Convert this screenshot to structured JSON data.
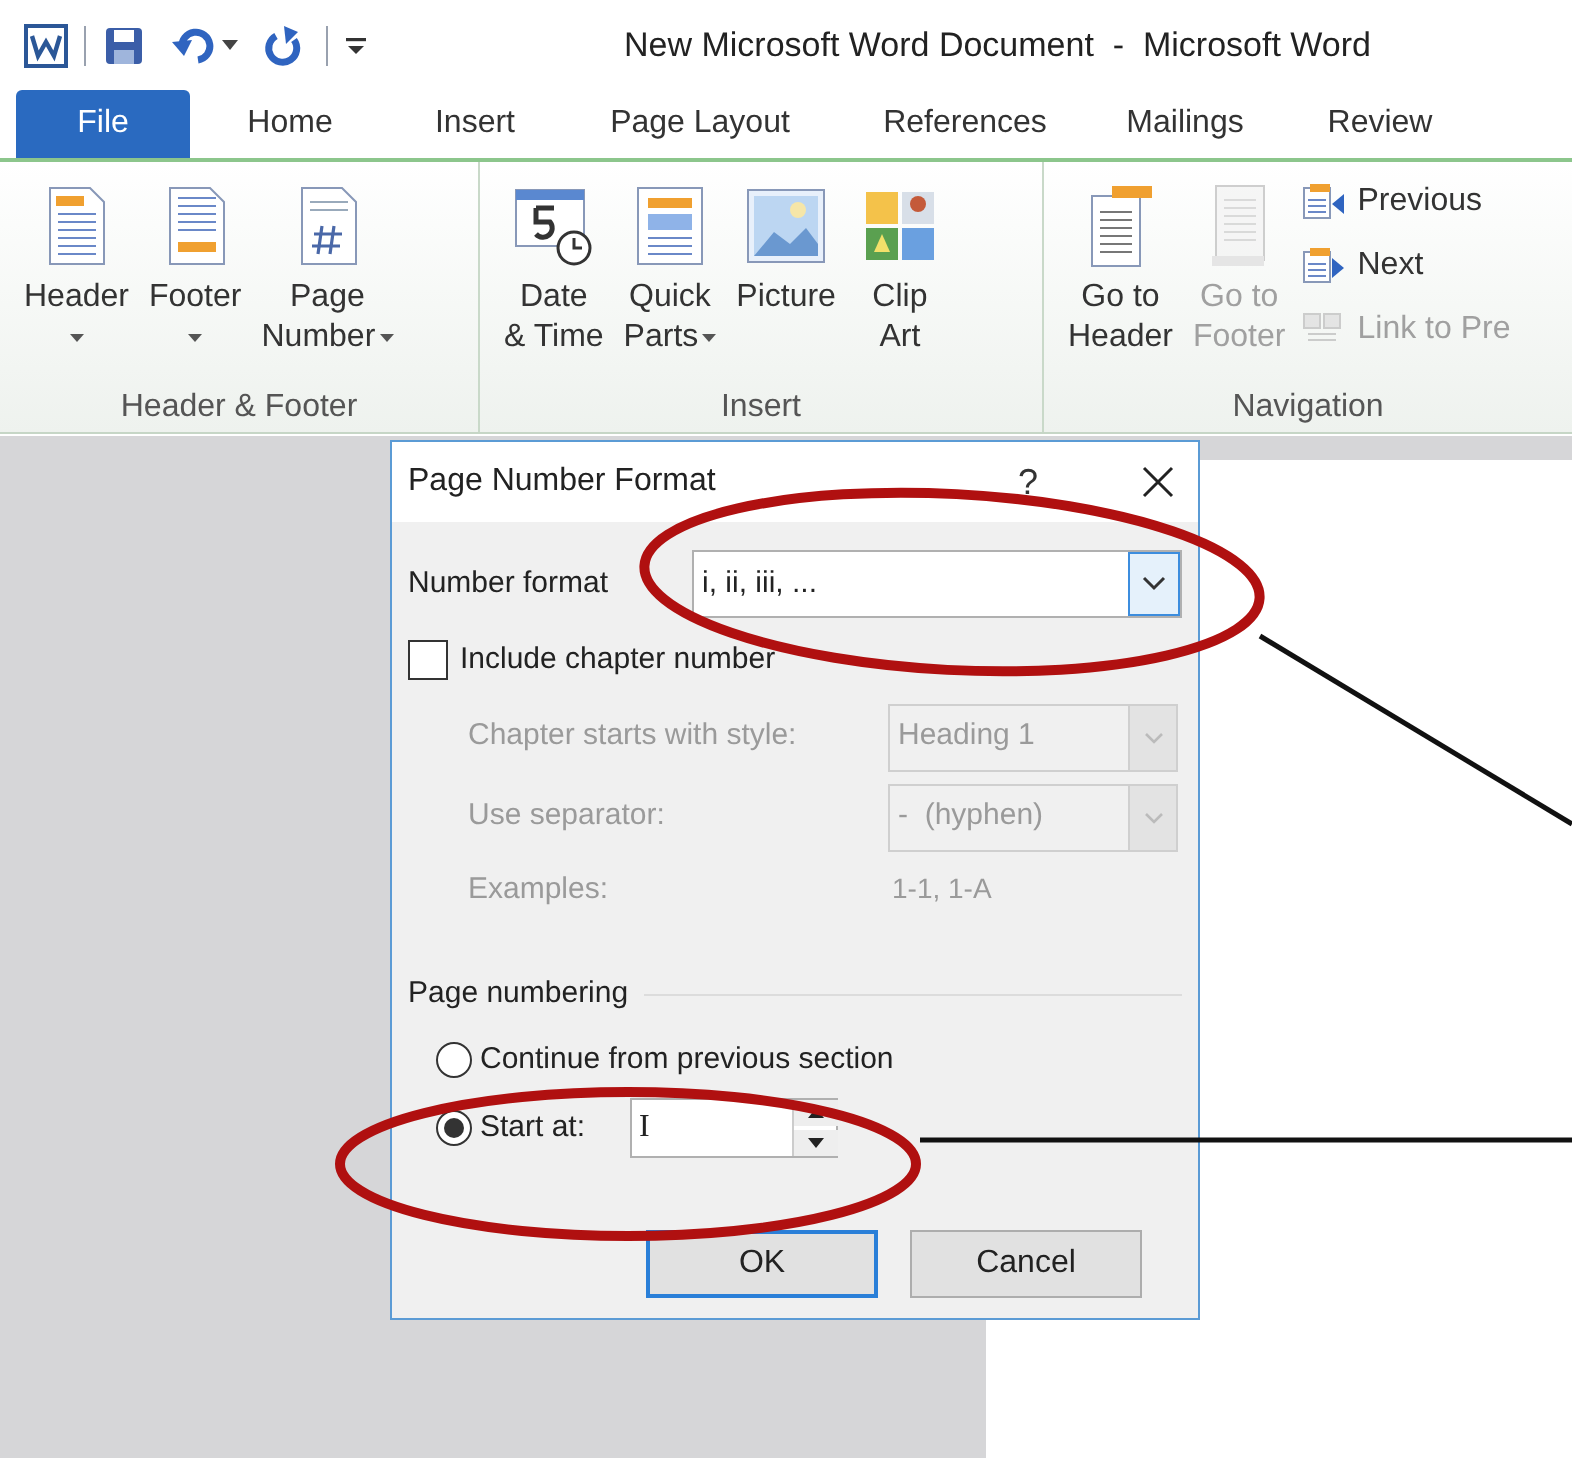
{
  "title_bar": {
    "title": "New Microsoft Word Document  -  Microsoft Word"
  },
  "tabs": [
    {
      "label": "File",
      "kind": "backstage",
      "selected": false
    },
    {
      "label": "Home",
      "kind": "tab",
      "selected": false
    },
    {
      "label": "Insert",
      "kind": "tab",
      "selected": false
    },
    {
      "label": "Page Layout",
      "kind": "tab",
      "selected": false
    },
    {
      "label": "References",
      "kind": "tab",
      "selected": false
    },
    {
      "label": "Mailings",
      "kind": "tab",
      "selected": false
    },
    {
      "label": "Review",
      "kind": "tab",
      "selected": false
    }
  ],
  "ribbon_groups": [
    {
      "label": "Header & Footer",
      "buttons": [
        {
          "kind": "large",
          "lines": [
            "Header"
          ],
          "dropdown": true,
          "disabled": false
        },
        {
          "kind": "large",
          "lines": [
            "Footer"
          ],
          "dropdown": true,
          "disabled": false
        },
        {
          "kind": "large",
          "lines": [
            "Page",
            "Number"
          ],
          "dropdown": true,
          "disabled": false
        }
      ]
    },
    {
      "label": "Insert",
      "buttons": [
        {
          "kind": "large",
          "lines": [
            "Date",
            "& Time"
          ],
          "dropdown": false,
          "disabled": false
        },
        {
          "kind": "large",
          "lines": [
            "Quick",
            "Parts"
          ],
          "dropdown": true,
          "disabled": false
        },
        {
          "kind": "large",
          "lines": [
            "Picture"
          ],
          "dropdown": false,
          "disabled": false
        },
        {
          "kind": "large",
          "lines": [
            "Clip",
            "Art"
          ],
          "dropdown": false,
          "disabled": false
        }
      ]
    },
    {
      "label": "Navigation",
      "buttons": [
        {
          "kind": "large",
          "lines": [
            "Go to",
            "Header"
          ],
          "dropdown": false,
          "disabled": false
        },
        {
          "kind": "large",
          "lines": [
            "Go to",
            "Footer"
          ],
          "dropdown": false,
          "disabled": true
        },
        {
          "kind": "small",
          "lines": [
            "Previous"
          ],
          "disabled": false
        },
        {
          "kind": "small",
          "lines": [
            "Next"
          ],
          "disabled": false
        },
        {
          "kind": "small",
          "lines": [
            "Link to Pre"
          ],
          "disabled": true
        }
      ]
    }
  ],
  "dialog": {
    "title": "Page Number Format",
    "help": "?",
    "number_format": {
      "label": "Number format",
      "value": "i, ii, iii, ..."
    },
    "include_chapter": {
      "label": "Include chapter number",
      "checked": false
    },
    "chapter_fields": [
      {
        "label": "Chapter starts with style:",
        "value": "Heading 1",
        "disabled": true
      },
      {
        "label": "Use separator:",
        "value": "-  (hyphen)",
        "disabled": true
      }
    ],
    "examples": {
      "label": "Examples:",
      "value": "1-1, 1-A"
    },
    "page_numbering": {
      "heading": "Page numbering",
      "options": [
        {
          "label": "Continue from previous section",
          "selected": false
        },
        {
          "label": "Start at:",
          "selected": true
        }
      ],
      "start_at": "I"
    },
    "buttons": [
      {
        "label": "OK",
        "default": true
      },
      {
        "label": "Cancel",
        "default": false
      }
    ]
  }
}
